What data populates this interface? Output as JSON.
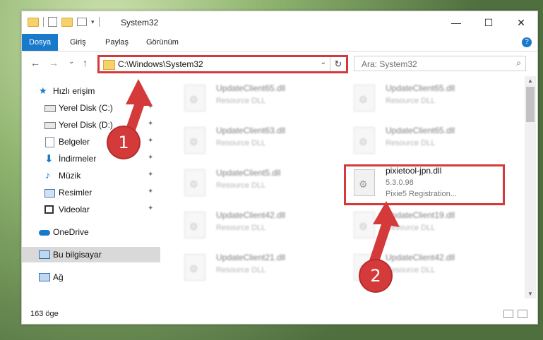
{
  "window": {
    "title": "System32"
  },
  "controls": {
    "minimize": "—",
    "maximize": "☐",
    "close": "✕"
  },
  "ribbon": {
    "tabs": [
      "Dosya",
      "Giriş",
      "Paylaş",
      "Görünüm"
    ],
    "help": "?"
  },
  "nav": {
    "back": "←",
    "forward": "→",
    "recent": "⌄",
    "up": "↑"
  },
  "address": {
    "path": "C:\\Windows\\System32",
    "dropdown": "⌄",
    "refresh": "↻"
  },
  "search": {
    "placeholder": "Ara: System32",
    "icon": "⌕"
  },
  "sidebar": {
    "items": [
      {
        "label": "Hızlı erişim",
        "icon": "star-icon",
        "pin": ""
      },
      {
        "label": "Yerel Disk (C:)",
        "icon": "drive-icon",
        "pin": "✦"
      },
      {
        "label": "Yerel Disk (D:)",
        "icon": "drive-icon",
        "pin": "✦"
      },
      {
        "label": "Belgeler",
        "icon": "documents-icon",
        "pin": "✦"
      },
      {
        "label": "İndirmeler",
        "icon": "download-icon",
        "pin": "✦"
      },
      {
        "label": "Müzik",
        "icon": "music-icon",
        "pin": "✦"
      },
      {
        "label": "Resimler",
        "icon": "pictures-icon",
        "pin": "✦"
      },
      {
        "label": "Videolar",
        "icon": "video-icon",
        "pin": "✦"
      },
      {
        "label": "OneDrive",
        "icon": "cloud-icon",
        "pin": ""
      },
      {
        "label": "Bu bilgisayar",
        "icon": "computer-icon",
        "pin": ""
      },
      {
        "label": "Ağ",
        "icon": "network-icon",
        "pin": ""
      }
    ]
  },
  "files": [
    {
      "name": "UpdateClient65.dll",
      "desc": "Resource DLL"
    },
    {
      "name": "UpdateClient65.dll",
      "desc": "Resource DLL"
    },
    {
      "name": "UpdateClient63.dll",
      "desc": "Resource DLL"
    },
    {
      "name": "UpdateClient65.dll",
      "desc": "Resource DLL"
    },
    {
      "name": "UpdateClient5.dll",
      "desc": "Resource DLL"
    },
    {
      "name": "pixietool-jpn.dll",
      "desc": "5.3.0.98",
      "desc2": "Pixie5 Registration..."
    },
    {
      "name": "UpdateClient42.dll",
      "desc": "Resource DLL"
    },
    {
      "name": "UpdateClient19.dll",
      "desc": "Resource DLL"
    },
    {
      "name": "UpdateClient21.dll",
      "desc": "Resource DLL"
    },
    {
      "name": "UpdateClient42.dll",
      "desc": "Resource DLL"
    }
  ],
  "annotations": {
    "step1": "1",
    "step2": "2",
    "color": "#d43a3a"
  },
  "status": {
    "count": "163 öge"
  }
}
